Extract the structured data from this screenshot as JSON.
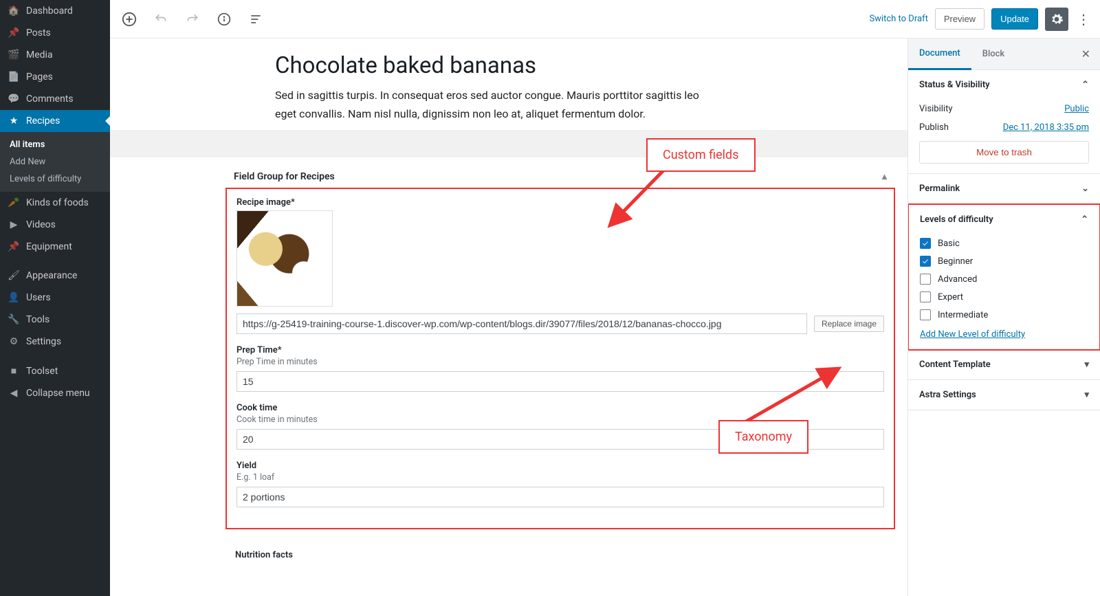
{
  "sidebar": {
    "items": [
      {
        "icon": "🏠",
        "label": "Dashboard",
        "type": "item"
      },
      {
        "icon": "📌",
        "label": "Posts",
        "type": "item"
      },
      {
        "icon": "🎬",
        "label": "Media",
        "type": "item"
      },
      {
        "icon": "📄",
        "label": "Pages",
        "type": "item"
      },
      {
        "icon": "💬",
        "label": "Comments",
        "type": "item"
      },
      {
        "icon": "★",
        "label": "Recipes",
        "type": "item",
        "selected": true
      },
      {
        "label": "All items",
        "type": "sub",
        "selected": true
      },
      {
        "label": "Add New",
        "type": "sub"
      },
      {
        "label": "Levels of difficulty",
        "type": "sub"
      },
      {
        "icon": "🥕",
        "label": "Kinds of foods",
        "type": "item"
      },
      {
        "icon": "▶",
        "label": "Videos",
        "type": "item"
      },
      {
        "icon": "📌",
        "label": "Equipment",
        "type": "item"
      },
      {
        "type": "spacer"
      },
      {
        "icon": "🖌",
        "label": "Appearance",
        "type": "item"
      },
      {
        "icon": "👤",
        "label": "Users",
        "type": "item"
      },
      {
        "icon": "🔧",
        "label": "Tools",
        "type": "item"
      },
      {
        "icon": "⚙",
        "label": "Settings",
        "type": "item"
      },
      {
        "type": "spacer"
      },
      {
        "icon": "■",
        "label": "Toolset",
        "type": "item"
      },
      {
        "icon": "◀",
        "label": "Collapse menu",
        "type": "item"
      }
    ]
  },
  "topbar": {
    "switch_draft": "Switch to Draft",
    "preview": "Preview",
    "update": "Update"
  },
  "post": {
    "title": "Chocolate baked bananas",
    "body": "Sed in sagittis turpis. In consequat eros sed auctor congue. Mauris porttitor sagittis leo eget convallis. Nam nisl nulla, dignissim non leo at, aliquet fermentum dolor."
  },
  "custom_fields": {
    "panel_title": "Field Group for Recipes",
    "recipe_image_label": "Recipe image*",
    "recipe_image_url": "https://g-25419-training-course-1.discover-wp.com/wp-content/blogs.dir/39077/files/2018/12/bananas-chocco.jpg",
    "replace_button": "Replace image",
    "prep_time_label": "Prep Time*",
    "prep_time_help": "Prep Time in minutes",
    "prep_time_value": "15",
    "cook_time_label": "Cook time",
    "cook_time_help": "Cook time in minutes",
    "cook_time_value": "20",
    "yield_label": "Yield",
    "yield_help": "E.g. 1 loaf",
    "yield_value": "2 portions",
    "nutrition_label": "Nutrition facts"
  },
  "settings": {
    "tabs": {
      "document": "Document",
      "block": "Block"
    },
    "status": {
      "title": "Status & Visibility",
      "visibility_label": "Visibility",
      "visibility_value": "Public",
      "publish_label": "Publish",
      "publish_value": "Dec 11, 2018 3:35 pm",
      "trash": "Move to trash"
    },
    "permalink_title": "Permalink",
    "levels": {
      "title": "Levels of difficulty",
      "items": [
        {
          "label": "Basic",
          "checked": true
        },
        {
          "label": "Beginner",
          "checked": true
        },
        {
          "label": "Advanced",
          "checked": false
        },
        {
          "label": "Expert",
          "checked": false
        },
        {
          "label": "Intermediate",
          "checked": false
        }
      ],
      "add_new": "Add New Level of difficulty"
    },
    "content_template_title": "Content Template",
    "astra_title": "Astra Settings"
  },
  "annotations": {
    "custom_fields": "Custom fields",
    "taxonomy": "Taxonomy"
  }
}
